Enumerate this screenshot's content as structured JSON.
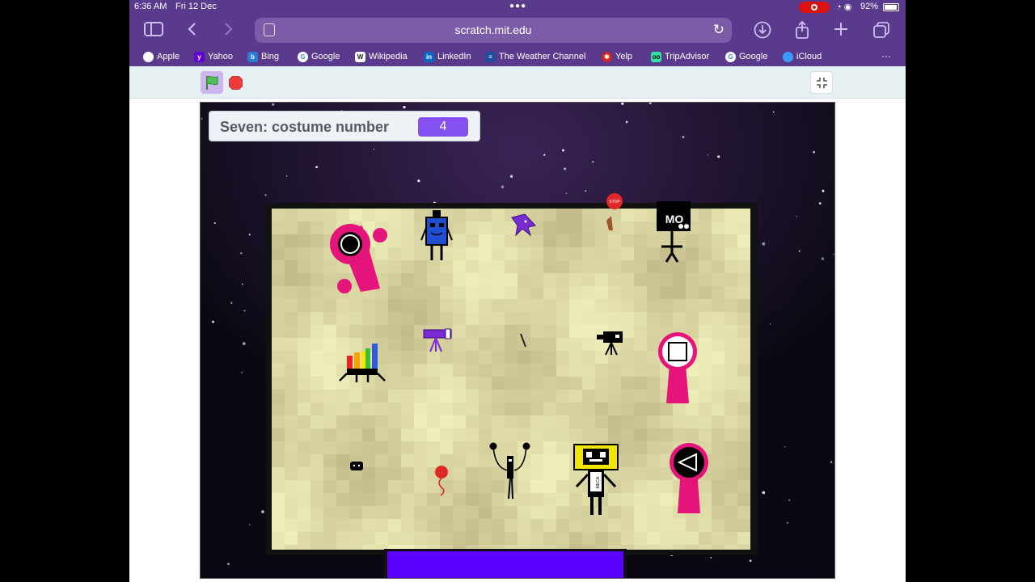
{
  "status_bar": {
    "time": "6:36 AM",
    "date": "Fri 12 Dec",
    "battery_pct": "92%"
  },
  "browser": {
    "url": "scratch.mit.edu",
    "bookmarks": [
      {
        "label": "Apple",
        "icon": "apple-icon",
        "color": "#ffffff"
      },
      {
        "label": "Yahoo",
        "icon": "yahoo-icon",
        "color": "#6001d2"
      },
      {
        "label": "Bing",
        "icon": "bing-icon",
        "color": "#2b7cd3"
      },
      {
        "label": "Google",
        "icon": "google-icon",
        "color": "#ffffff"
      },
      {
        "label": "Wikipedia",
        "icon": "wikipedia-icon",
        "color": "#ffffff"
      },
      {
        "label": "LinkedIn",
        "icon": "linkedin-icon",
        "color": "#0a66c2"
      },
      {
        "label": "The Weather Channel",
        "icon": "weather-channel-icon",
        "color": "#1f4ea0"
      },
      {
        "label": "Yelp",
        "icon": "yelp-icon",
        "color": "#d32323"
      },
      {
        "label": "TripAdvisor",
        "icon": "tripadvisor-icon",
        "color": "#34e0a1"
      },
      {
        "label": "Google",
        "icon": "google-icon",
        "color": "#ffffff"
      },
      {
        "label": "iCloud",
        "icon": "icloud-icon",
        "color": "#3b9cff"
      }
    ],
    "more_label": "···"
  },
  "scratch": {
    "monitor": {
      "label": "Seven: costume number",
      "value": "4"
    },
    "sign_texts": {
      "stop": "STOP",
      "meca": "MECA",
      "mo": "MO"
    }
  },
  "colors": {
    "chrome": "#5a3a8c",
    "monitor_value": "#8550f2",
    "green_flag": "#4cbf56",
    "stop": "#ec3b3b",
    "floor_light": "#eeeeb8",
    "floor_dark": "#c4bc8c",
    "pink": "#e5147a",
    "bottom_bar": "#5a00ff"
  }
}
